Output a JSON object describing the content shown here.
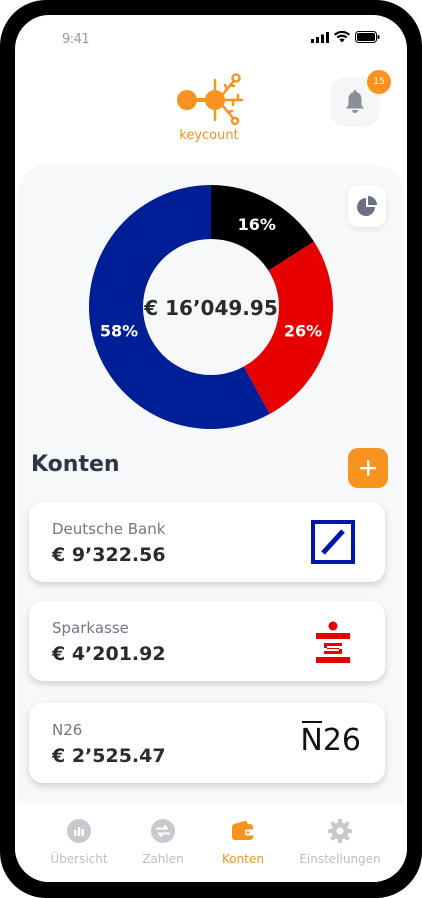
{
  "status_bar": {
    "time": "9:41"
  },
  "app": {
    "logo_text": "keycount"
  },
  "notifications": {
    "count": "15"
  },
  "overview": {
    "total": "€ 16’049.95"
  },
  "chart_data": {
    "type": "pie",
    "style": "donut",
    "slices": [
      {
        "label": "16%",
        "value": 16,
        "color": "#000000"
      },
      {
        "label": "26%",
        "value": 26,
        "color": "#e60000"
      },
      {
        "label": "58%",
        "value": 58,
        "color": "#001e96"
      }
    ],
    "center_label": "€ 16’049.95"
  },
  "accounts": {
    "title": "Konten",
    "add_label": "+",
    "items": [
      {
        "name": "Deutsche Bank",
        "amount": "€ 9’322.56",
        "logo": "deutsche-bank-logo"
      },
      {
        "name": "Sparkasse",
        "amount": "€ 4’201.92",
        "logo": "sparkasse-logo"
      },
      {
        "name": "N26",
        "amount": "€ 2’525.47",
        "logo": "n26-logo",
        "logo_text": "N26"
      }
    ]
  },
  "nav": {
    "items": [
      {
        "label": "Übersicht",
        "icon": "bar-chart-icon"
      },
      {
        "label": "Zahlen",
        "icon": "transfer-icon"
      },
      {
        "label": "Konten",
        "icon": "wallet-icon",
        "active": true
      },
      {
        "label": "Einstellungen",
        "icon": "gear-icon"
      }
    ]
  },
  "colors": {
    "accent": "#f7931e",
    "text_dark": "#2f3542",
    "muted": "#bcbec4"
  }
}
